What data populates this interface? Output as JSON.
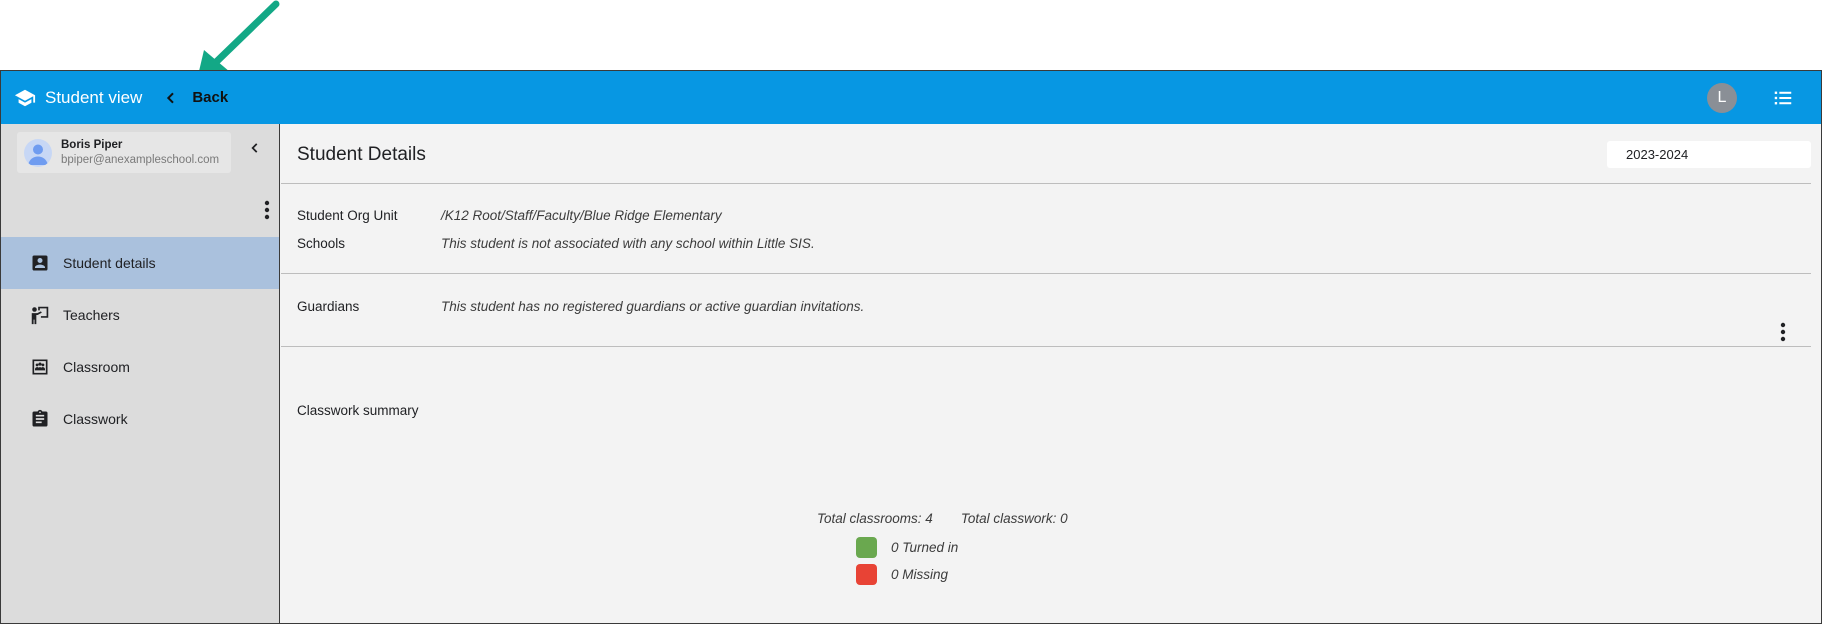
{
  "colors": {
    "topbar": "#0797e3",
    "annotation_arrow": "#13a886",
    "nav_active": "#aac1dd",
    "turned_in": "#6aa84f",
    "missing": "#e84335"
  },
  "header": {
    "brand_icon": "graduation-cap-icon",
    "title": "Student view",
    "back_label": "Back",
    "avatar_letter": "L",
    "menu_icon": "list-icon"
  },
  "sidebar": {
    "user": {
      "name": "Boris Piper",
      "email": "bpiper@anexampleschool.com"
    },
    "items": [
      {
        "label": "Student details",
        "icon": "account-box-icon",
        "active": true
      },
      {
        "label": "Teachers",
        "icon": "teacher-icon",
        "active": false
      },
      {
        "label": "Classroom",
        "icon": "classroom-icon",
        "active": false
      },
      {
        "label": "Classwork",
        "icon": "clipboard-icon",
        "active": false
      }
    ]
  },
  "main": {
    "title": "Student Details",
    "school_year": "2023-2024",
    "org_unit": {
      "label": "Student Org Unit",
      "value": "/K12 Root/Staff/Faculty/Blue Ridge Elementary"
    },
    "schools": {
      "label": "Schools",
      "value": "This student is not associated with any school within Little SIS."
    },
    "guardians": {
      "label": "Guardians",
      "value": "This student has no registered guardians or active guardian invitations."
    },
    "classwork": {
      "title": "Classwork summary",
      "total_classrooms": "Total classrooms: 4",
      "total_classwork": "Total classwork: 0",
      "turned_in": "0 Turned in",
      "missing": "0 Missing"
    }
  }
}
